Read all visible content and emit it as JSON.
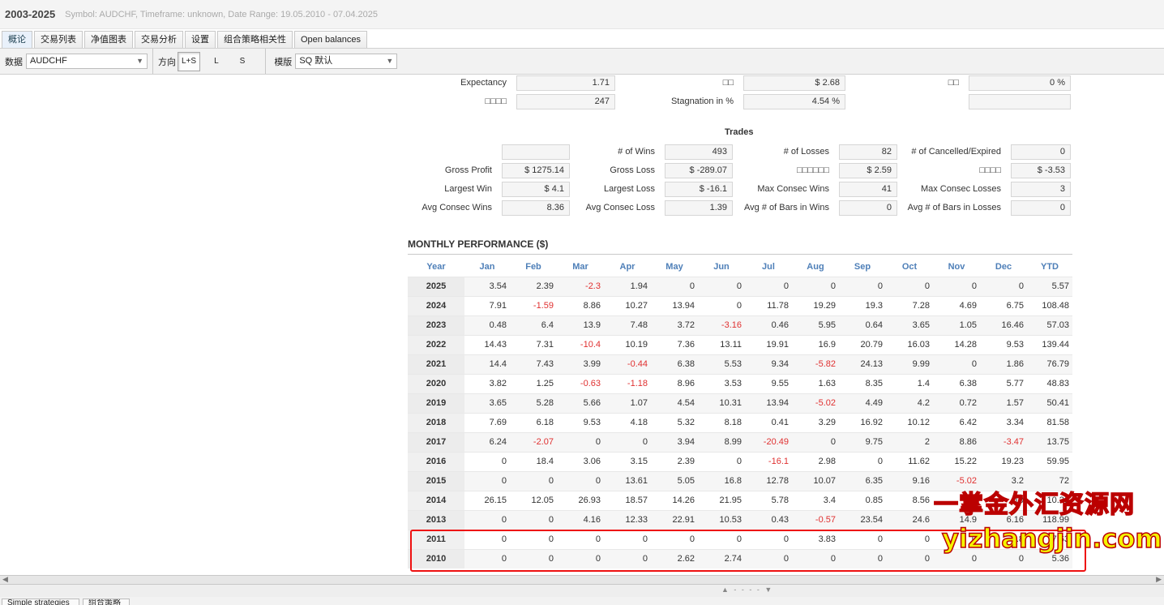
{
  "window": {
    "title": "2003-2025",
    "subtitle": "Symbol: AUDCHF, Timeframe: unknown, Date Range: 19.05.2010 - 07.04.2025"
  },
  "tabs": [
    {
      "label": "概论"
    },
    {
      "label": "交易列表"
    },
    {
      "label": "净值图表"
    },
    {
      "label": "交易分析"
    },
    {
      "label": "设置"
    },
    {
      "label": "组合策略相关性"
    },
    {
      "label": "Open balances"
    }
  ],
  "toolbar": {
    "data_label": "数据",
    "data_value": "AUDCHF",
    "direction_label": "方向",
    "directions": [
      "L+S",
      "L",
      "S"
    ],
    "template_label": "模版",
    "template_value": "SQ 默认"
  },
  "top_stats": {
    "expectancy_label": "Expectancy",
    "expectancy_value": "1.71",
    "r1_mid_label": "□□",
    "r1_mid_value": "$ 2.68",
    "r1_right_label": "□□",
    "r1_right_value": "0 %",
    "r2_left_label": "□□□□",
    "r2_left_value": "247",
    "stagnation_label": "Stagnation in %",
    "stagnation_value": "4.54 %",
    "r2_right_value": ""
  },
  "trades": {
    "title": "Trades",
    "rows": [
      [
        "",
        "",
        "# of Wins",
        "493",
        "# of Losses",
        "82",
        "# of Cancelled/Expired",
        "0"
      ],
      [
        "Gross Profit",
        "$ 1275.14",
        "Gross Loss",
        "$ -289.07",
        "□□□□□□",
        "$ 2.59",
        "□□□□",
        "$ -3.53"
      ],
      [
        "Largest Win",
        "$ 4.1",
        "Largest Loss",
        "$ -16.1",
        "Max Consec Wins",
        "41",
        "Max Consec Losses",
        "3"
      ],
      [
        "Avg Consec Wins",
        "8.36",
        "Avg Consec Loss",
        "1.39",
        "Avg # of Bars in Wins",
        "0",
        "Avg # of Bars in Losses",
        "0"
      ]
    ]
  },
  "monthly": {
    "title": "MONTHLY PERFORMANCE ($)",
    "headers": [
      "Year",
      "Jan",
      "Feb",
      "Mar",
      "Apr",
      "May",
      "Jun",
      "Jul",
      "Aug",
      "Sep",
      "Oct",
      "Nov",
      "Dec",
      "YTD"
    ],
    "rows": [
      [
        "2025",
        "3.54",
        "2.39",
        "-2.3",
        "1.94",
        "0",
        "0",
        "0",
        "0",
        "0",
        "0",
        "0",
        "0",
        "5.57"
      ],
      [
        "2024",
        "7.91",
        "-1.59",
        "8.86",
        "10.27",
        "13.94",
        "0",
        "11.78",
        "19.29",
        "19.3",
        "7.28",
        "4.69",
        "6.75",
        "108.48"
      ],
      [
        "2023",
        "0.48",
        "6.4",
        "13.9",
        "7.48",
        "3.72",
        "-3.16",
        "0.46",
        "5.95",
        "0.64",
        "3.65",
        "1.05",
        "16.46",
        "57.03"
      ],
      [
        "2022",
        "14.43",
        "7.31",
        "-10.4",
        "10.19",
        "7.36",
        "13.11",
        "19.91",
        "16.9",
        "20.79",
        "16.03",
        "14.28",
        "9.53",
        "139.44"
      ],
      [
        "2021",
        "14.4",
        "7.43",
        "3.99",
        "-0.44",
        "6.38",
        "5.53",
        "9.34",
        "-5.82",
        "24.13",
        "9.99",
        "0",
        "1.86",
        "76.79"
      ],
      [
        "2020",
        "3.82",
        "1.25",
        "-0.63",
        "-1.18",
        "8.96",
        "3.53",
        "9.55",
        "1.63",
        "8.35",
        "1.4",
        "6.38",
        "5.77",
        "48.83"
      ],
      [
        "2019",
        "3.65",
        "5.28",
        "5.66",
        "1.07",
        "4.54",
        "10.31",
        "13.94",
        "-5.02",
        "4.49",
        "4.2",
        "0.72",
        "1.57",
        "50.41"
      ],
      [
        "2018",
        "7.69",
        "6.18",
        "9.53",
        "4.18",
        "5.32",
        "8.18",
        "0.41",
        "3.29",
        "16.92",
        "10.12",
        "6.42",
        "3.34",
        "81.58"
      ],
      [
        "2017",
        "6.24",
        "-2.07",
        "0",
        "0",
        "3.94",
        "8.99",
        "-20.49",
        "0",
        "9.75",
        "2",
        "8.86",
        "-3.47",
        "13.75"
      ],
      [
        "2016",
        "0",
        "18.4",
        "3.06",
        "3.15",
        "2.39",
        "0",
        "-16.1",
        "2.98",
        "0",
        "11.62",
        "15.22",
        "19.23",
        "59.95"
      ],
      [
        "2015",
        "0",
        "0",
        "0",
        "13.61",
        "5.05",
        "16.8",
        "12.78",
        "10.07",
        "6.35",
        "9.16",
        "-5.02",
        "3.2",
        "72"
      ],
      [
        "2014",
        "26.15",
        "12.05",
        "26.93",
        "18.57",
        "14.26",
        "21.95",
        "5.78",
        "3.4",
        "0.85",
        "8.56",
        "10",
        "10",
        "10.26"
      ],
      [
        "2013",
        "0",
        "0",
        "4.16",
        "12.33",
        "22.91",
        "10.53",
        "0.43",
        "-0.57",
        "23.54",
        "24.6",
        "14.9",
        "6.16",
        "118.99"
      ],
      [
        "2011",
        "0",
        "0",
        "0",
        "0",
        "0",
        "0",
        "0",
        "3.83",
        "0",
        "0",
        "0",
        "3.8",
        "7.63"
      ],
      [
        "2010",
        "0",
        "0",
        "0",
        "0",
        "2.62",
        "2.74",
        "0",
        "0",
        "0",
        "0",
        "0",
        "0",
        "5.36"
      ]
    ]
  },
  "watermark": {
    "line1": "一掌金外汇资源网",
    "line2": "yizhangjin.com"
  },
  "bottom_tabs": [
    "Simple strategies",
    "组合策略"
  ]
}
